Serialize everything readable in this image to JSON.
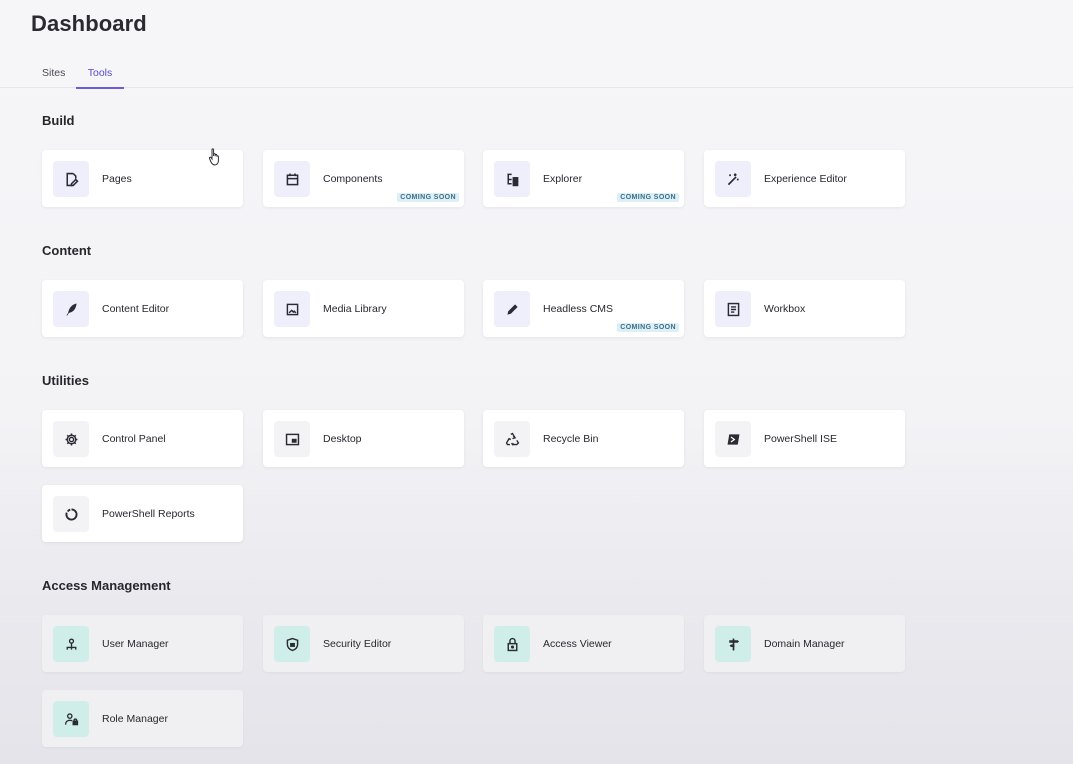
{
  "header": {
    "title": "Dashboard"
  },
  "tabs": [
    {
      "label": "Sites"
    },
    {
      "label": "Tools",
      "active": true
    }
  ],
  "accent_color": "#6a5bd6",
  "sections": [
    {
      "title": "Build",
      "items": [
        {
          "label": "Pages",
          "icon": "page-edit-icon"
        },
        {
          "label": "Components",
          "icon": "calendar-icon",
          "badge": "COMING SOON"
        },
        {
          "label": "Explorer",
          "icon": "tree-icon",
          "badge": "COMING SOON"
        },
        {
          "label": "Experience Editor",
          "icon": "magic-wand-icon"
        }
      ]
    },
    {
      "title": "Content",
      "items": [
        {
          "label": "Content Editor",
          "icon": "feather-icon"
        },
        {
          "label": "Media Library",
          "icon": "image-icon"
        },
        {
          "label": "Headless CMS",
          "icon": "pencil-icon",
          "badge": "COMING SOON"
        },
        {
          "label": "Workbox",
          "icon": "list-box-icon"
        }
      ]
    },
    {
      "title": "Utilities",
      "items": [
        {
          "label": "Control Panel",
          "icon": "gear-icon"
        },
        {
          "label": "Desktop",
          "icon": "desktop-icon"
        },
        {
          "label": "Recycle Bin",
          "icon": "recycle-icon"
        },
        {
          "label": "PowerShell ISE",
          "icon": "terminal-icon"
        },
        {
          "label": "PowerShell Reports",
          "icon": "ring-chart-icon"
        }
      ]
    },
    {
      "title": "Access Management",
      "items": [
        {
          "label": "User Manager",
          "icon": "user-network-icon"
        },
        {
          "label": "Security Editor",
          "icon": "shield-icon"
        },
        {
          "label": "Access Viewer",
          "icon": "lock-icon"
        },
        {
          "label": "Domain Manager",
          "icon": "signpost-icon"
        },
        {
          "label": "Role Manager",
          "icon": "user-lock-icon"
        }
      ]
    }
  ]
}
